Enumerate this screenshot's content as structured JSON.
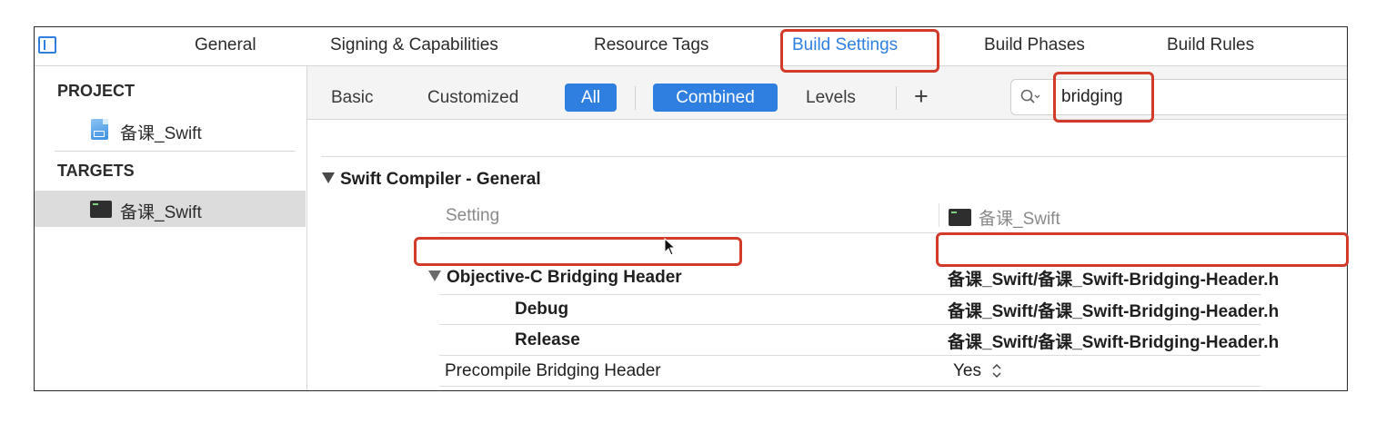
{
  "tabs": [
    {
      "label": "General"
    },
    {
      "label": "Signing & Capabilities"
    },
    {
      "label": "Resource Tags"
    },
    {
      "label": "Build Settings",
      "active": true
    },
    {
      "label": "Build Phases"
    },
    {
      "label": "Build Rules"
    }
  ],
  "sidebar": {
    "project_header": "PROJECT",
    "project_item": "备课_Swift",
    "targets_header": "TARGETS",
    "target_item": "备课_Swift"
  },
  "filter_bar": {
    "basic": "Basic",
    "customized": "Customized",
    "all": "All",
    "combined": "Combined",
    "levels": "Levels",
    "add": "+",
    "search_value": "bridging"
  },
  "settings": {
    "group_title": "Swift Compiler - General",
    "column_setting": "Setting",
    "column_target": "备课_Swift",
    "rows": [
      {
        "label": "Objective-C Bridging Header",
        "value": "备课_Swift/备课_Swift-Bridging-Header.h"
      },
      {
        "label": "Debug",
        "value": "备课_Swift/备课_Swift-Bridging-Header.h"
      },
      {
        "label": "Release",
        "value": "备课_Swift/备课_Swift-Bridging-Header.h"
      },
      {
        "label": "Precompile Bridging Header",
        "value": "Yes"
      }
    ]
  },
  "colors": {
    "accent": "#2f7fe0",
    "highlight": "#d23a2a",
    "selected_row": "#dcdcdc"
  }
}
